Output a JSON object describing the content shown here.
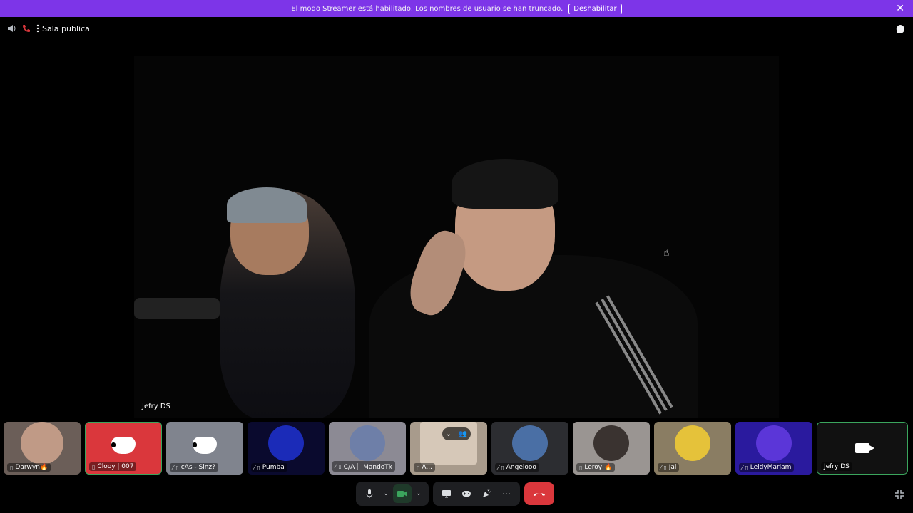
{
  "banner": {
    "message": "El modo Streamer está habilitado. Los nombres de usuario se han truncado.",
    "button": "Deshabilitar",
    "close": "✕"
  },
  "header": {
    "channel": "Sala publica"
  },
  "stage": {
    "speaker": "Jefry DS"
  },
  "participants": [
    {
      "name": "Darwyn🔥"
    },
    {
      "name": "Clooy | 007"
    },
    {
      "name": "cAs - Sinz?"
    },
    {
      "name": "Pumba"
    },
    {
      "name": "C/A｜ MandoTk"
    },
    {
      "name": "A..."
    },
    {
      "name": "Angelooo"
    },
    {
      "name": "Leroy 🔥"
    },
    {
      "name": "Jai"
    },
    {
      "name": "LeidyMariam"
    },
    {
      "name": "Jefry DS"
    }
  ],
  "colors": {
    "banner": "#7d35e8",
    "discord_red": "#da373c",
    "discord_gray": "#80848e",
    "speaking_green": "#3ba55d"
  }
}
